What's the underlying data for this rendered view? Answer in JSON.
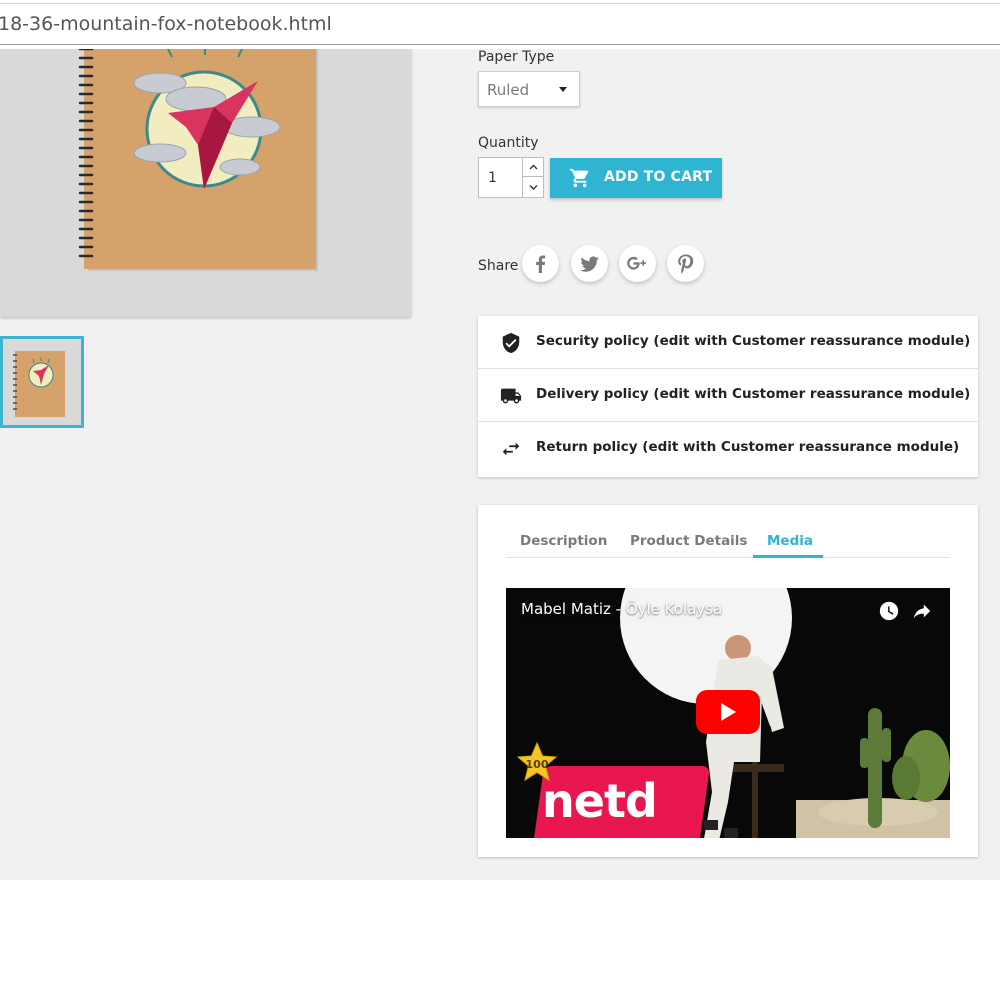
{
  "browser": {
    "url": "18-36-mountain-fox-notebook.html"
  },
  "product": {
    "paper_type_label": "Paper Type",
    "paper_type_value": "Ruled",
    "quantity_label": "Quantity",
    "quantity_value": "1",
    "add_to_cart_label": "ADD TO CART",
    "share_label": "Share"
  },
  "share_buttons": [
    {
      "icon": "facebook-icon"
    },
    {
      "icon": "twitter-icon"
    },
    {
      "icon": "google-plus-icon"
    },
    {
      "icon": "pinterest-icon"
    }
  ],
  "reassurance": [
    {
      "icon": "shield-check-icon",
      "text": "Security policy (edit with Customer reassurance module)"
    },
    {
      "icon": "truck-icon",
      "text": "Delivery policy (edit with Customer reassurance module)"
    },
    {
      "icon": "swap-arrows-icon",
      "text": "Return policy (edit with Customer reassurance module)"
    }
  ],
  "tabs": [
    {
      "label": "Description",
      "active": false
    },
    {
      "label": "Product Details",
      "active": false
    },
    {
      "label": "Media",
      "active": true
    }
  ],
  "video": {
    "title": "Mabel Matiz - Öyle Kolaysa",
    "badge": "100",
    "logo_text": "netd"
  },
  "colors": {
    "accent": "#2fb5d2",
    "page_bg": "#f1f1f1",
    "youtube_red": "#ff0000",
    "netd_pink": "#e8174f"
  }
}
